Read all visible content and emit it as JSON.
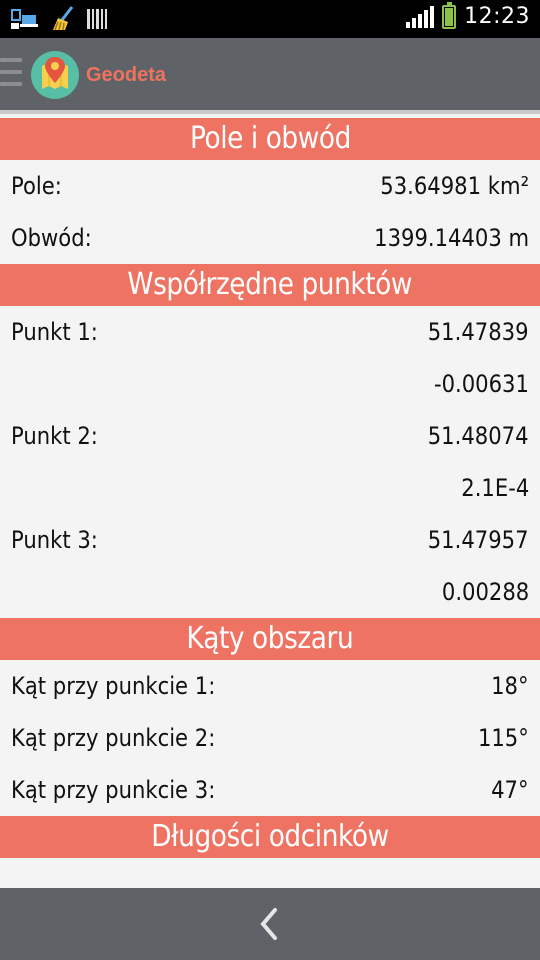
{
  "status_bar": {
    "time": "12:23",
    "icons": [
      "device-icon",
      "broom-icon",
      "barcode-icon",
      "signal-icon",
      "battery-icon"
    ]
  },
  "app_bar": {
    "title": "Geodeta",
    "logo_icon": "map-pin-icon",
    "menu_icon": "hamburger-icon"
  },
  "sections": {
    "area_perimeter": {
      "title": "Pole i obwód",
      "rows": [
        {
          "label": "Pole:",
          "value": "53.64981 km²"
        },
        {
          "label": "Obwód:",
          "value": "1399.14403 m"
        }
      ]
    },
    "coordinates": {
      "title": "Współrzędne punktów",
      "points": [
        {
          "label": "Punkt 1:",
          "lat": "51.47839",
          "lon": "-0.00631"
        },
        {
          "label": "Punkt 2:",
          "lat": "51.48074",
          "lon": "2.1E-4"
        },
        {
          "label": "Punkt 3:",
          "lat": "51.47957",
          "lon": "0.00288"
        }
      ]
    },
    "angles": {
      "title": "Kąty obszaru",
      "rows": [
        {
          "label": "Kąt przy punkcie 1:",
          "value": "18°"
        },
        {
          "label": "Kąt przy punkcie 2:",
          "value": "115°"
        },
        {
          "label": "Kąt przy punkcie 3:",
          "value": "47°"
        }
      ]
    },
    "segments": {
      "title": "Długości odcinków"
    }
  },
  "bottom_bar": {
    "back_icon": "chevron-left-icon"
  },
  "colors": {
    "accent": "#ee7363",
    "app_bar": "#5f6368",
    "logo_bg": "#58bfa6",
    "title": "#ee735f"
  }
}
